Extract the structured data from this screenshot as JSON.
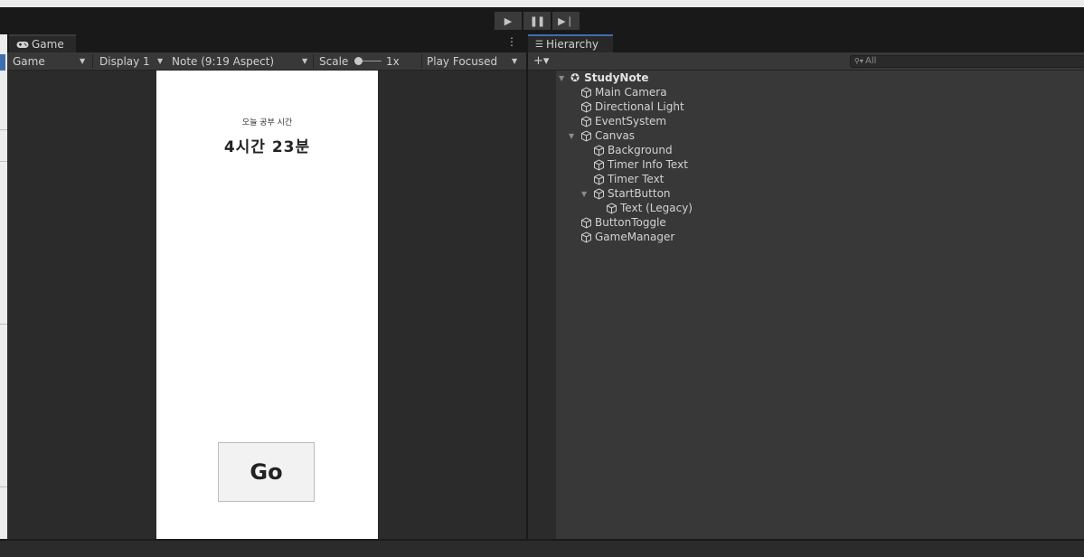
{
  "colors": {
    "editor_dark": "#191919",
    "panel": "#282828",
    "toolbar": "#383838",
    "hierarchy_content": "#383838",
    "accent_tab": "#3d6fb0",
    "game_canvas": "#ffffff"
  },
  "playmode": {
    "play_icon": "play-icon",
    "pause_icon": "pause-icon",
    "step_icon": "step-icon"
  },
  "game_panel": {
    "tab_icon": "gamepad-icon",
    "tab_label": "Game",
    "menu_icon": "kebab-menu-icon",
    "toolbar": {
      "view_mode": "Game",
      "display": "Display 1",
      "aspect": "Note (9:19 Aspect)",
      "scale_label": "Scale",
      "scale_value": "1x",
      "play_mode": "Play Focused"
    },
    "game_ui": {
      "study_label": "오늘 공부 시간",
      "timer_text": "4시간 23분",
      "button_label": "Go"
    }
  },
  "hierarchy": {
    "tab_icon": "hierarchy-list-icon",
    "tab_label": "Hierarchy",
    "add_label": "+▾",
    "search_placeholder": "All",
    "scene": "StudyNote",
    "items": [
      {
        "label": "Main Camera",
        "depth": 1,
        "expanded": null
      },
      {
        "label": "Directional Light",
        "depth": 1,
        "expanded": null
      },
      {
        "label": "EventSystem",
        "depth": 1,
        "expanded": null
      },
      {
        "label": "Canvas",
        "depth": 1,
        "expanded": true
      },
      {
        "label": "Background",
        "depth": 2,
        "expanded": null
      },
      {
        "label": "Timer Info Text",
        "depth": 2,
        "expanded": null
      },
      {
        "label": "Timer Text",
        "depth": 2,
        "expanded": null
      },
      {
        "label": "StartButton",
        "depth": 2,
        "expanded": true
      },
      {
        "label": "Text (Legacy)",
        "depth": 3,
        "expanded": null
      },
      {
        "label": "ButtonToggle",
        "depth": 1,
        "expanded": null
      },
      {
        "label": "GameManager",
        "depth": 1,
        "expanded": null
      }
    ]
  }
}
